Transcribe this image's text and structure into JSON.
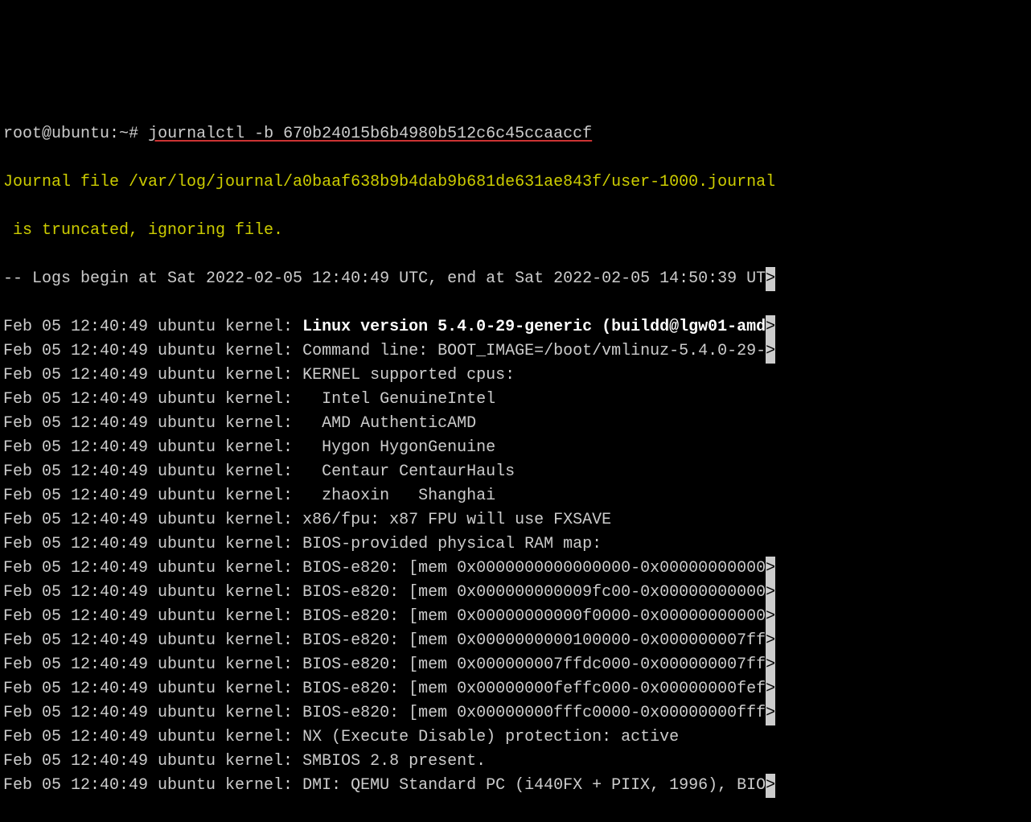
{
  "prompt": {
    "user_host": "root@ubuntu",
    "path": "~",
    "symbol": "#",
    "command": "journalctl -b 670b24015b6b4980b512c6c45ccaaccf"
  },
  "warning_line1": "Journal file /var/log/journal/a0baaf638b9b4dab9b681de631ae843f/user-1000.journal",
  "warning_line2": " is truncated, ignoring file.",
  "header": "-- Logs begin at Sat 2022-02-05 12:40:49 UTC, end at Sat 2022-02-05 14:50:39 UT",
  "entries": [
    {
      "ts": "Feb 05 12:40:49 ubuntu kernel: ",
      "msg": "Linux version 5.4.0-29-generic (buildd@lgw01-amd",
      "bold": true,
      "trunc": true
    },
    {
      "ts": "Feb 05 12:40:49 ubuntu kernel: ",
      "msg": "Command line: BOOT_IMAGE=/boot/vmlinuz-5.4.0-29-",
      "trunc": true
    },
    {
      "ts": "Feb 05 12:40:49 ubuntu kernel: ",
      "msg": "KERNEL supported cpus:"
    },
    {
      "ts": "Feb 05 12:40:49 ubuntu kernel: ",
      "msg": "  Intel GenuineIntel"
    },
    {
      "ts": "Feb 05 12:40:49 ubuntu kernel: ",
      "msg": "  AMD AuthenticAMD"
    },
    {
      "ts": "Feb 05 12:40:49 ubuntu kernel: ",
      "msg": "  Hygon HygonGenuine"
    },
    {
      "ts": "Feb 05 12:40:49 ubuntu kernel: ",
      "msg": "  Centaur CentaurHauls"
    },
    {
      "ts": "Feb 05 12:40:49 ubuntu kernel: ",
      "msg": "  zhaoxin   Shanghai"
    },
    {
      "ts": "Feb 05 12:40:49 ubuntu kernel: ",
      "msg": "x86/fpu: x87 FPU will use FXSAVE"
    },
    {
      "ts": "Feb 05 12:40:49 ubuntu kernel: ",
      "msg": "BIOS-provided physical RAM map:"
    },
    {
      "ts": "Feb 05 12:40:49 ubuntu kernel: ",
      "msg": "BIOS-e820: [mem 0x0000000000000000-0x00000000000",
      "trunc": true
    },
    {
      "ts": "Feb 05 12:40:49 ubuntu kernel: ",
      "msg": "BIOS-e820: [mem 0x000000000009fc00-0x00000000000",
      "trunc": true
    },
    {
      "ts": "Feb 05 12:40:49 ubuntu kernel: ",
      "msg": "BIOS-e820: [mem 0x00000000000f0000-0x00000000000",
      "trunc": true
    },
    {
      "ts": "Feb 05 12:40:49 ubuntu kernel: ",
      "msg": "BIOS-e820: [mem 0x0000000000100000-0x000000007ff",
      "trunc": true
    },
    {
      "ts": "Feb 05 12:40:49 ubuntu kernel: ",
      "msg": "BIOS-e820: [mem 0x000000007ffdc000-0x000000007ff",
      "trunc": true
    },
    {
      "ts": "Feb 05 12:40:49 ubuntu kernel: ",
      "msg": "BIOS-e820: [mem 0x00000000feffc000-0x00000000fef",
      "trunc": true
    },
    {
      "ts": "Feb 05 12:40:49 ubuntu kernel: ",
      "msg": "BIOS-e820: [mem 0x00000000fffc0000-0x00000000fff",
      "trunc": true
    },
    {
      "ts": "Feb 05 12:40:49 ubuntu kernel: ",
      "msg": "NX (Execute Disable) protection: active"
    },
    {
      "ts": "Feb 05 12:40:49 ubuntu kernel: ",
      "msg": "SMBIOS 2.8 present."
    },
    {
      "ts": "Feb 05 12:40:49 ubuntu kernel: ",
      "msg": "DMI: QEMU Standard PC (i440FX + PIIX, 1996), BIO",
      "trunc": true
    }
  ],
  "trunc_char": ">"
}
